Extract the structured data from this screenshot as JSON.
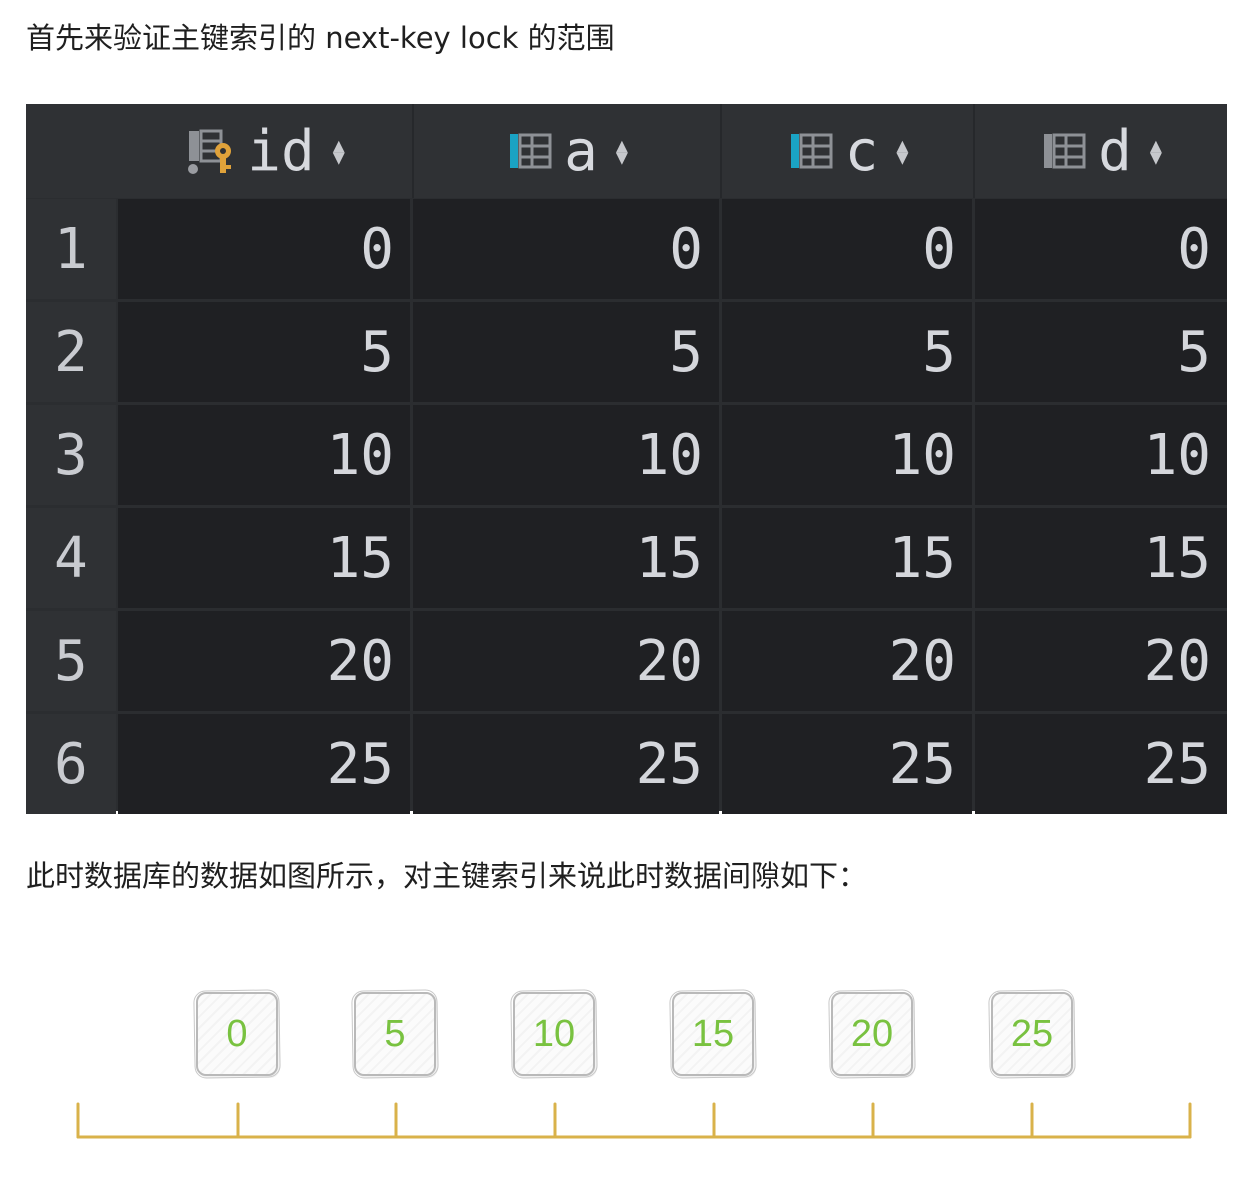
{
  "intro_text": "首先来验证主键索引的 next-key lock 的范围",
  "table": {
    "columns": [
      {
        "name": "id",
        "icon": "primary-key-column-icon"
      },
      {
        "name": "a",
        "icon": "indexed-column-icon"
      },
      {
        "name": "c",
        "icon": "indexed-column-icon"
      },
      {
        "name": "d",
        "icon": "column-icon"
      }
    ],
    "rows": [
      {
        "num": "1",
        "cells": [
          "0",
          "0",
          "0",
          "0"
        ]
      },
      {
        "num": "2",
        "cells": [
          "5",
          "5",
          "5",
          "5"
        ]
      },
      {
        "num": "3",
        "cells": [
          "10",
          "10",
          "10",
          "10"
        ]
      },
      {
        "num": "4",
        "cells": [
          "15",
          "15",
          "15",
          "15"
        ]
      },
      {
        "num": "5",
        "cells": [
          "20",
          "20",
          "20",
          "20"
        ]
      },
      {
        "num": "6",
        "cells": [
          "25",
          "25",
          "25",
          "25"
        ]
      }
    ],
    "colors": {
      "key_icon": "#e0a23a",
      "index_marker": "#1aa3c4"
    }
  },
  "caption_text": "此时数据库的数据如图所示，对主键索引来说此时数据间隙如下：",
  "gap_diagram": {
    "values": [
      "0",
      "5",
      "10",
      "15",
      "20",
      "25"
    ],
    "value_color": "#79c240",
    "line_color": "#d9b24a"
  }
}
